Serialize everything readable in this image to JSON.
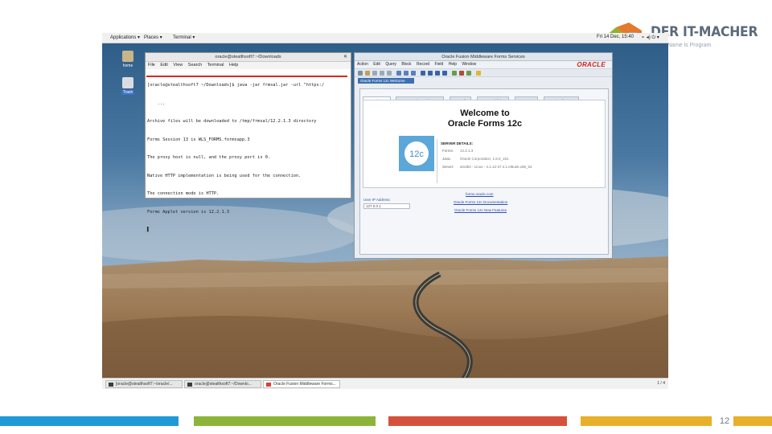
{
  "brand": {
    "name": "DER IT-MACHER",
    "subtitle": "Name is Program",
    "colors": {
      "green": "#8cb32a",
      "orange": "#e37a2d",
      "blue": "#2e86c1",
      "text": "#5c6a7a"
    }
  },
  "desktop": {
    "topbar": {
      "applications": "Applications ▾",
      "places": "Places ▾",
      "terminal": "Terminal ▾",
      "clock": "Fri 14 Dec, 15:40"
    },
    "icons": [
      {
        "label": "home",
        "icon": "home-folder-icon"
      },
      {
        "label": "Trash",
        "icon": "trash-icon"
      }
    ]
  },
  "terminal": {
    "title": "oracle@stealthsoft7:~/Downloads",
    "menu": [
      "File",
      "Edit",
      "View",
      "Search",
      "Terminal",
      "Help"
    ],
    "lines": [
      "[oracle@stealthsoft7 ~/Downloads]$ java -jar frmsal.jar -url \"https:/",
      "    ...",
      "Archive files will be downloaded to /tmp/frmsal/12.2.1.3 directory",
      "Forms Session 13 is WLS_FORMS.formsapp.3",
      "The proxy host is null, and the proxy port is 0.",
      "Native HTTP implementation is being used for the connection.",
      "The connection mode is HTTP.",
      "Forms Applet version is 12.2.1.3"
    ]
  },
  "forms": {
    "title": "Oracle Fusion Middleware Forms Services",
    "menu": [
      "Action",
      "Edit",
      "Query",
      "Block",
      "Record",
      "Field",
      "Help",
      "Window"
    ],
    "oracle_logo": "ORACLE",
    "status_text": "Oracle Forms 12c Welcome",
    "tabs": [
      "Welcome",
      "Properties and Events",
      "Audio",
      "BI-Publisher",
      "Mouse",
      "Miscellaneous"
    ],
    "welcome_line1": "Welcome to",
    "welcome_line2": "Oracle Forms 12c",
    "badge": "12c",
    "server_header": "SERVER DETAILS:",
    "server_rows": [
      {
        "key": "Forms:",
        "value": "12.2.1.3"
      },
      {
        "key": "Java:",
        "value": "Oracle Corporation, 1.8.0_151"
      },
      {
        "key": "Server:",
        "value": "amd64 - Linux - 4.1.12-37.4.1.el6uek.x86_64"
      }
    ],
    "ip_label": "User IP Address:",
    "ip_value": "127.0.0.1",
    "links": [
      "forms.oracle.com",
      "Oracle Forms 12c Documentation",
      "Oracle Forms 12c New Features"
    ]
  },
  "taskbar": {
    "tasks": [
      "[oracle@stealthsoft7:~/oracle/...",
      "oracle@stealthsoft7:~/Downlo...",
      "Oracle Fusion Middleware Forms..."
    ],
    "pager": "1 / 4"
  },
  "footer": {
    "page_number": "12",
    "colors": [
      "#1f9ad6",
      "#8db43a",
      "#d6513c",
      "#e8b02a"
    ]
  }
}
